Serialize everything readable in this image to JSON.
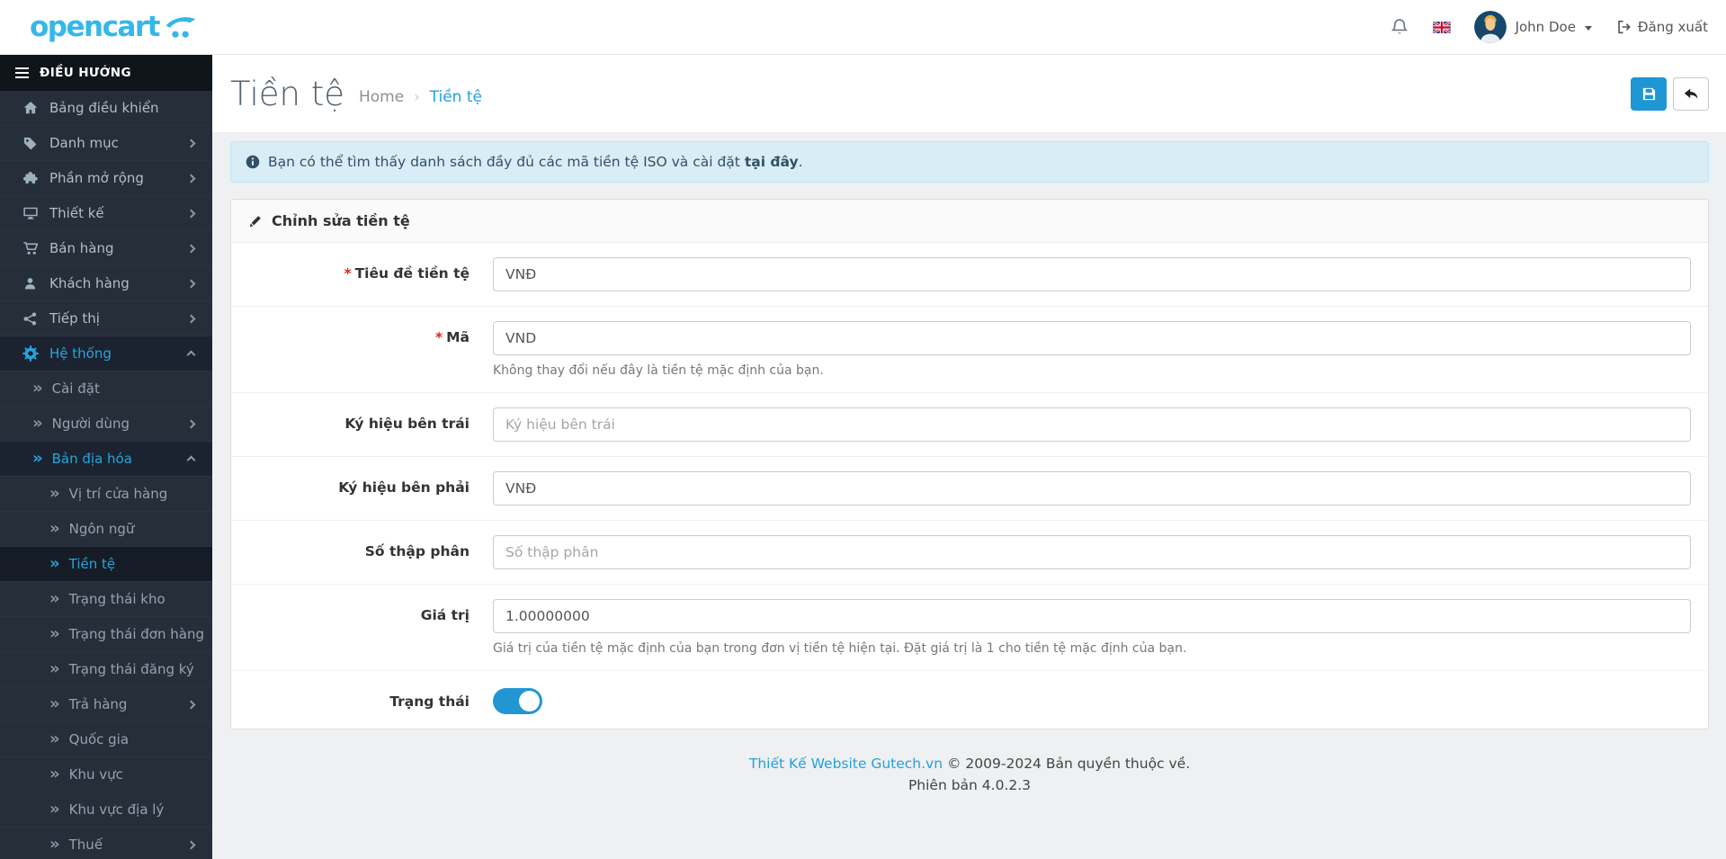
{
  "colors": {
    "brand_logo": "#36b7e9",
    "accent_link": "#23a1db",
    "sidebar_bg": "#262e39",
    "sidebar_header_bg": "#10151c",
    "sidebar_active_text": "#29a3dc",
    "save_button_bg": "#1e97d4",
    "alert_bg": "#d9edf7",
    "alert_border": "#bce8f1",
    "toggle_on": "#2196d3",
    "required_asterisk": "#e02222"
  },
  "header": {
    "logo_text": "opencart",
    "user_name": "John Doe",
    "logout_label": "Đăng xuất"
  },
  "sidebar": {
    "nav_title": "ĐIỀU HƯỚNG",
    "items": [
      {
        "id": "dashboard",
        "label": "Bảng điều khiển",
        "icon": "home-icon",
        "level": 0
      },
      {
        "id": "catalog",
        "label": "Danh mục",
        "icon": "tag-icon",
        "level": 0,
        "chevron": "right"
      },
      {
        "id": "extensions",
        "label": "Phần mở rộng",
        "icon": "puzzle-icon",
        "level": 0,
        "chevron": "right"
      },
      {
        "id": "design",
        "label": "Thiết kế",
        "icon": "monitor-icon",
        "level": 0,
        "chevron": "right"
      },
      {
        "id": "sales",
        "label": "Bán hàng",
        "icon": "cart-icon",
        "level": 0,
        "chevron": "right"
      },
      {
        "id": "customers",
        "label": "Khách hàng",
        "icon": "user-icon",
        "level": 0,
        "chevron": "right"
      },
      {
        "id": "marketing",
        "label": "Tiếp thị",
        "icon": "share-icon",
        "level": 0,
        "chevron": "right"
      },
      {
        "id": "system",
        "label": "Hệ thống",
        "icon": "gear-icon",
        "level": 0,
        "chevron": "up",
        "state": "expanded"
      },
      {
        "id": "settings",
        "label": "Cài đặt",
        "icon": "angles-icon",
        "level": 1
      },
      {
        "id": "users",
        "label": "Người dùng",
        "icon": "angles-icon",
        "level": 1,
        "chevron": "right"
      },
      {
        "id": "localisation",
        "label": "Bản địa hóa",
        "icon": "angles-icon",
        "level": 1,
        "chevron": "up",
        "state": "expanded"
      },
      {
        "id": "store-location",
        "label": "Vị trí cửa hàng",
        "icon": "angles-icon",
        "level": 2
      },
      {
        "id": "languages",
        "label": "Ngôn ngữ",
        "icon": "angles-icon",
        "level": 2
      },
      {
        "id": "currencies",
        "label": "Tiền tệ",
        "icon": "angles-icon",
        "level": 2,
        "state": "current"
      },
      {
        "id": "stock-statuses",
        "label": "Trạng thái kho",
        "icon": "angles-icon",
        "level": 2
      },
      {
        "id": "order-statuses",
        "label": "Trạng thái đơn hàng",
        "icon": "angles-icon",
        "level": 2
      },
      {
        "id": "subscription-statuses",
        "label": "Trạng thái đăng ký",
        "icon": "angles-icon",
        "level": 2
      },
      {
        "id": "returns",
        "label": "Trả hàng",
        "icon": "angles-icon",
        "level": 2,
        "chevron": "right"
      },
      {
        "id": "countries",
        "label": "Quốc gia",
        "icon": "angles-icon",
        "level": 2
      },
      {
        "id": "zones",
        "label": "Khu vực",
        "icon": "angles-icon",
        "level": 2
      },
      {
        "id": "geo-zones",
        "label": "Khu vực địa lý",
        "icon": "angles-icon",
        "level": 2
      },
      {
        "id": "taxes",
        "label": "Thuế",
        "icon": "angles-icon",
        "level": 2,
        "chevron": "right"
      }
    ]
  },
  "page": {
    "title": "Tiền tệ",
    "breadcrumb": [
      {
        "label": "Home"
      },
      {
        "label": "Tiền tệ"
      }
    ]
  },
  "alert": {
    "text": "Bạn có thể tìm thấy danh sách đầy đủ các mã tiền tệ ISO và cài đặt",
    "link_text": "tại đây",
    "suffix": "."
  },
  "form": {
    "title": "Chỉnh sửa tiền tệ",
    "fields": [
      {
        "id": "currency-title",
        "label": "Tiêu đề tiền tệ",
        "required": true,
        "value": "VNĐ"
      },
      {
        "id": "code",
        "label": "Mã",
        "required": true,
        "value": "VND",
        "help": "Không thay đổi nếu đây là tiền tệ mặc định của bạn."
      },
      {
        "id": "symbol-left",
        "label": "Ký hiệu bên trái",
        "value": "",
        "placeholder": "Ký hiệu bên trái"
      },
      {
        "id": "symbol-right",
        "label": "Ký hiệu bên phải",
        "value": "VNĐ"
      },
      {
        "id": "decimal-places",
        "label": "Số thập phân",
        "value": "",
        "placeholder": "Số thập phân"
      },
      {
        "id": "value",
        "label": "Giá trị",
        "value": "1.00000000",
        "help": "Giá trị của tiền tệ mặc định của bạn trong đơn vị tiền tệ hiện tại. Đặt giá trị là 1 cho tiền tệ mặc định của bạn."
      },
      {
        "id": "status",
        "label": "Trạng thái",
        "type": "toggle",
        "value": "on"
      }
    ]
  },
  "footer": {
    "link_text": "Thiết Kế Website Gutech.vn",
    "copyright": "© 2009-2024 Bản quyền thuộc về.",
    "version": "Phiên bản 4.0.2.3"
  }
}
